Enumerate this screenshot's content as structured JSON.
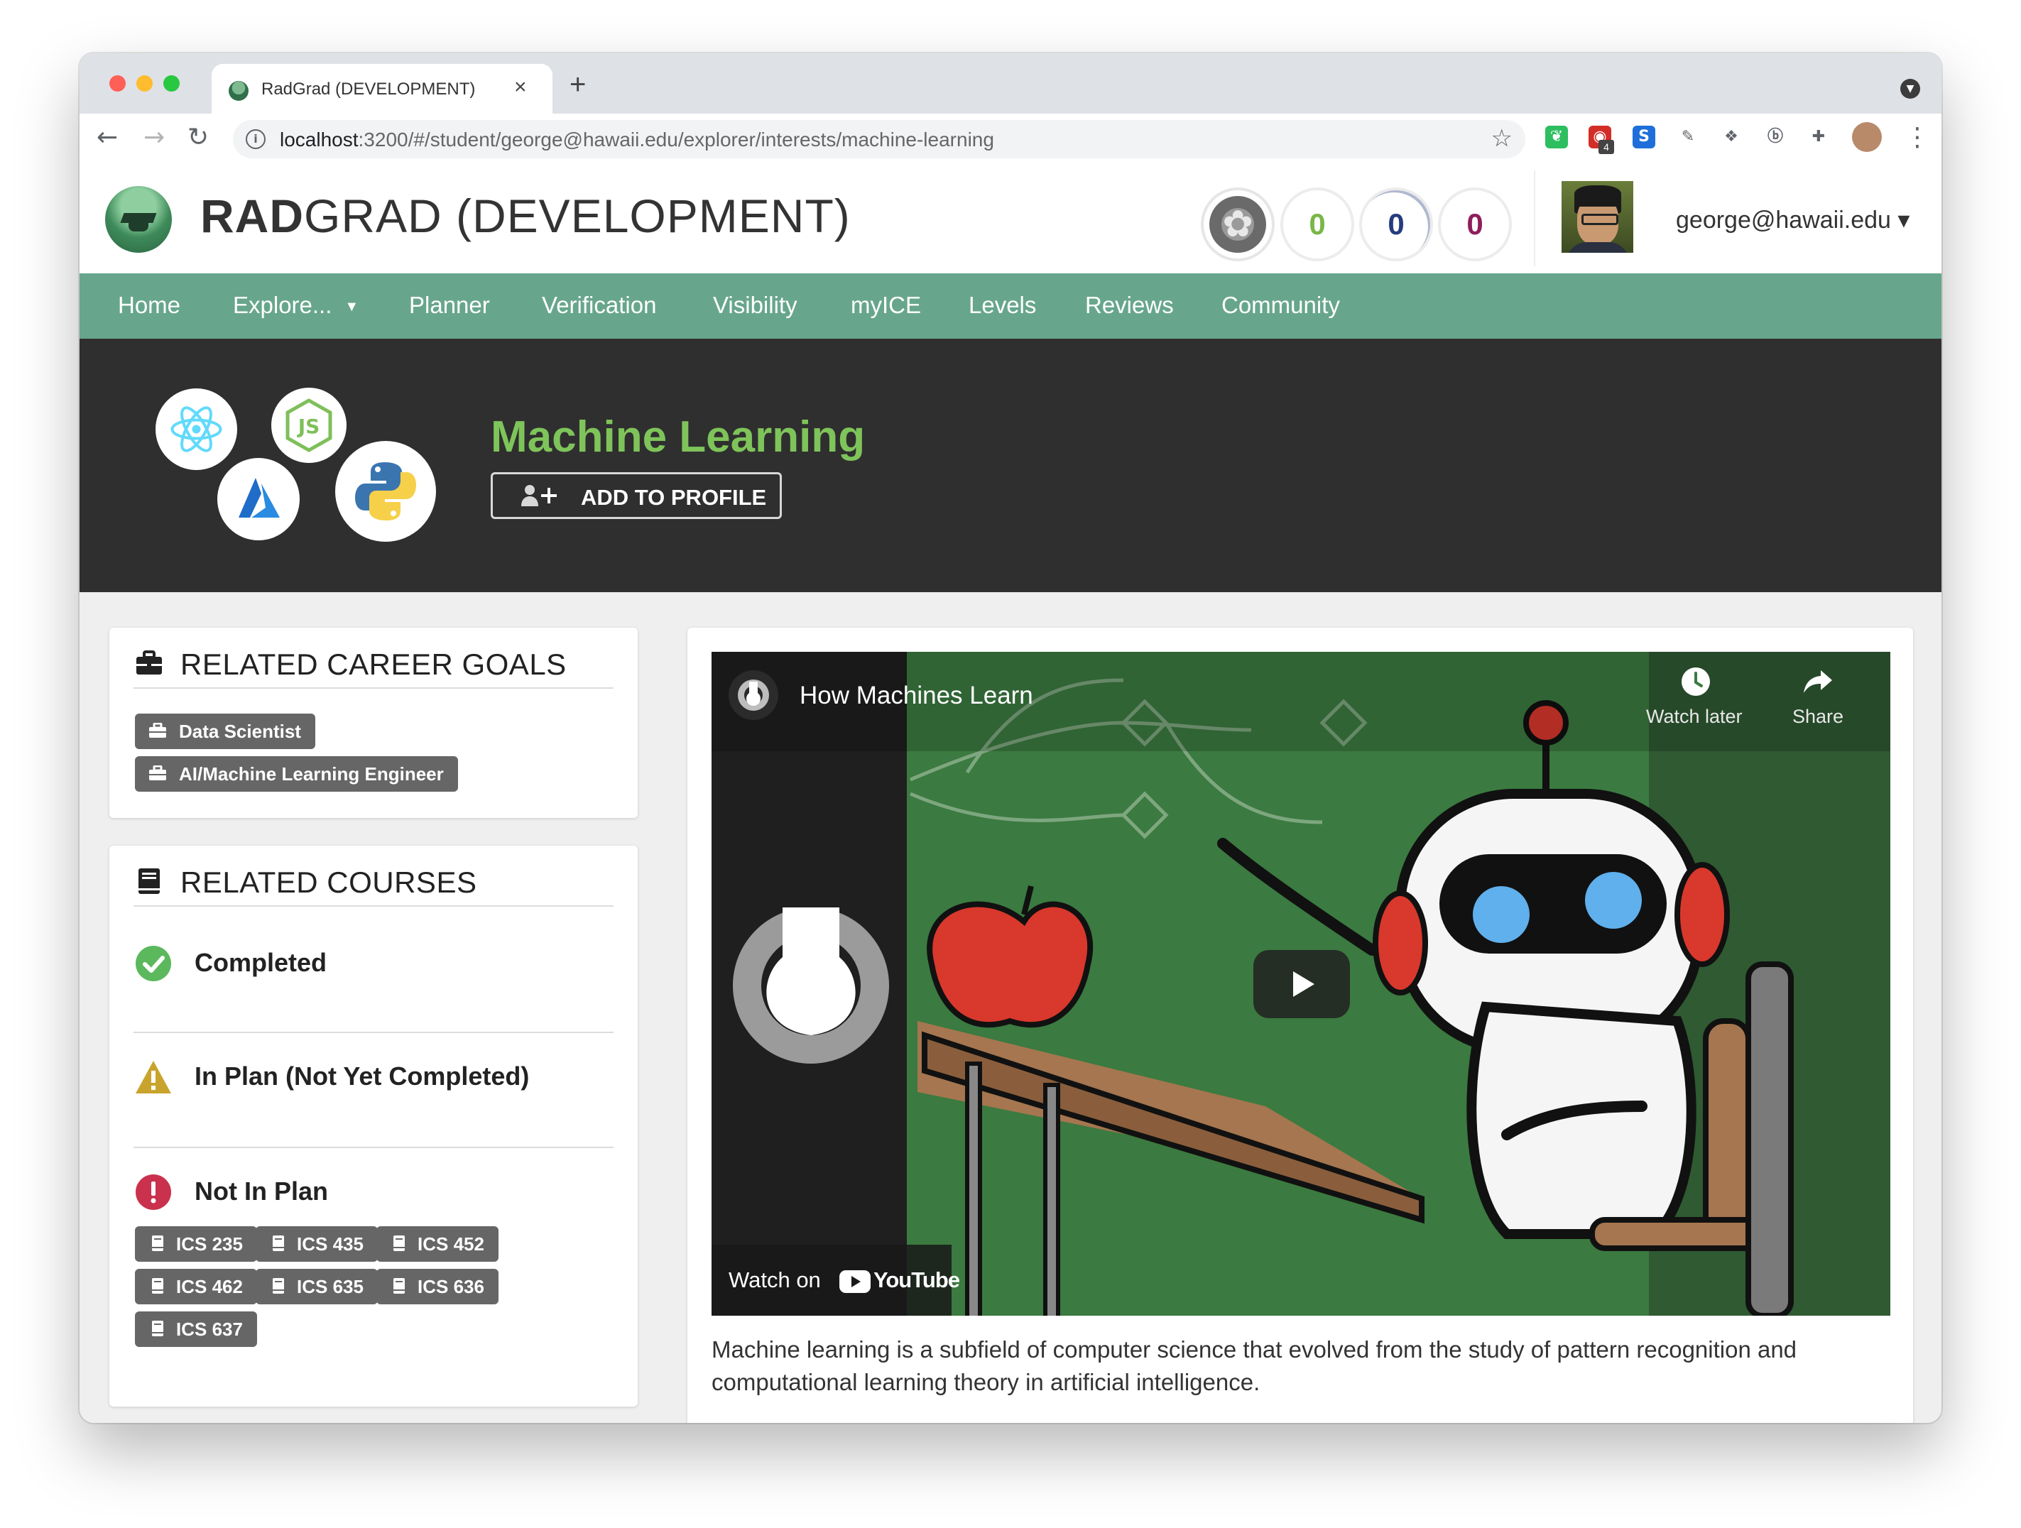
{
  "browser": {
    "tab_title": "RadGrad (DEVELOPMENT)",
    "tab_close": "×",
    "new_tab": "+",
    "url_host": "localhost",
    "url_path": ":3200/#/student/george@hawaii.edu/explorer/interests/machine-learning",
    "extensions": [
      {
        "name": "evernote-icon",
        "color": "#2dbe60",
        "glyph": "❦"
      },
      {
        "name": "lastpass-icon",
        "color": "#d32d27",
        "glyph": "◉",
        "badge": "4"
      },
      {
        "name": "s-extension-icon",
        "color": "#1e6fd9",
        "glyph": "S"
      },
      {
        "name": "eyedropper-icon",
        "color": "#ffffff",
        "glyph": "✎"
      },
      {
        "name": "dropbox-icon",
        "color": "#ffffff",
        "glyph": "❖"
      },
      {
        "name": "b-extension-icon",
        "color": "#ffffff",
        "glyph": "ⓑ"
      },
      {
        "name": "puzzle-icon",
        "color": "#ffffff",
        "glyph": "✚"
      }
    ]
  },
  "header": {
    "brand_bold": "RAD",
    "brand_rest": "GRAD (DEVELOPMENT)",
    "ice": {
      "innovation": "0",
      "competency": "0",
      "experience": "0"
    },
    "ice_colors": {
      "innovation": "#7ab648",
      "competency": "#253c7d",
      "experience": "#8e1e5c"
    },
    "user_email": "george@hawaii.edu",
    "user_caret": "▾"
  },
  "nav": {
    "items": [
      "Home",
      "Explore...",
      "Planner",
      "Verification",
      "Visibility",
      "myICE",
      "Levels",
      "Reviews",
      "Community"
    ],
    "explore_caret": "▼"
  },
  "hero": {
    "title": "Machine Learning",
    "add_button": "ADD TO PROFILE",
    "add_icon": "+"
  },
  "career_goals": {
    "title": "RELATED CAREER GOALS",
    "items": [
      "Data Scientist",
      "AI/Machine Learning Engineer"
    ]
  },
  "courses": {
    "title": "RELATED COURSES",
    "completed_label": "Completed",
    "in_plan_label": "In Plan (Not Yet Completed)",
    "not_in_plan_label": "Not In Plan",
    "not_in_plan": [
      "ICS 235",
      "ICS 435",
      "ICS 452",
      "ICS 462",
      "ICS 635",
      "ICS 636",
      "ICS 637"
    ]
  },
  "video": {
    "title": "How Machines Learn",
    "watch_later": "Watch later",
    "share": "Share",
    "watch_on": "Watch on",
    "youtube": "YouTube"
  },
  "description": "Machine learning is a subfield of computer science that evolved from the study of pattern recognition and computational learning theory in artificial intelligence.",
  "colors": {
    "nav_green": "#67a68d",
    "hero_bg": "#2f2f2f",
    "title_green": "#7ec45a",
    "pill_gray": "#666666"
  }
}
